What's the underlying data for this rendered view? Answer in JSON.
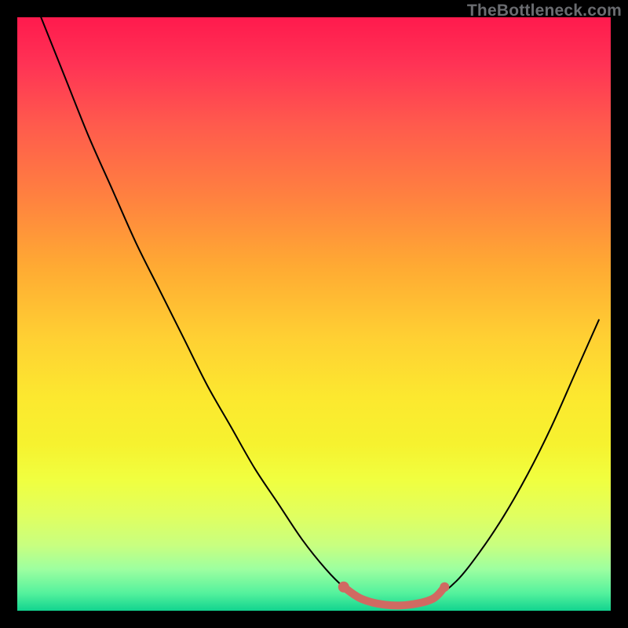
{
  "attribution": "TheBottleneck.com",
  "colors": {
    "curve_stroke": "#000000",
    "optimal_stroke": "#d06a62",
    "background_black": "#000000"
  },
  "chart_data": {
    "type": "line",
    "title": "",
    "xlabel": "",
    "ylabel": "",
    "xlim": [
      0,
      100
    ],
    "ylim": [
      0,
      100
    ],
    "series": [
      {
        "name": "bottleneck_curve",
        "x": [
          4,
          8,
          12,
          16,
          20,
          24,
          28,
          32,
          36,
          40,
          44,
          48,
          52,
          55,
          58,
          62,
          66,
          70,
          74,
          78,
          82,
          86,
          90,
          94,
          98
        ],
        "y": [
          100,
          90,
          80,
          71,
          62,
          54,
          46,
          38,
          31,
          24,
          18,
          12,
          7,
          4,
          2,
          1,
          1,
          2,
          5,
          10,
          16,
          23,
          31,
          40,
          49
        ]
      },
      {
        "name": "optimal_zone",
        "x": [
          55,
          58,
          62,
          66,
          70,
          72
        ],
        "y": [
          4,
          2,
          1,
          1,
          2,
          4
        ]
      }
    ]
  }
}
